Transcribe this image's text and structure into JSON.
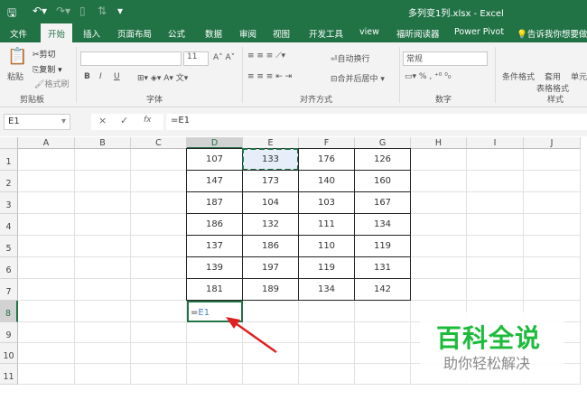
{
  "window": {
    "title": "多列变1列.xlsx  -  Excel",
    "quick_access": [
      "save-icon",
      "undo-icon",
      "redo-icon",
      "print-preview-icon",
      "sort-icon",
      "customize-icon"
    ]
  },
  "tabs": [
    "文件",
    "开始",
    "插入",
    "页面布局",
    "公式",
    "数据",
    "审阅",
    "视图",
    "开发工具",
    "view",
    "福昕阅读器",
    "Power Pivot",
    "告诉我你想要做什么"
  ],
  "ribbon": {
    "clipboard": {
      "paste": "粘贴",
      "cut": "剪切",
      "copy": "复制",
      "format_painter": "格式刷",
      "group": "剪贴板"
    },
    "font": {
      "font_name": "",
      "font_size": "11",
      "bold": "B",
      "italic": "I",
      "underline": "U",
      "group": "字体"
    },
    "alignment": {
      "wrap": "自动换行",
      "merge": "合并后居中",
      "group": "对齐方式"
    },
    "number": {
      "format": "常规",
      "percent": "%",
      "group": "数字"
    },
    "styles": {
      "conditional": "条件格式",
      "table": "套用\n表格格式",
      "cell": "单元",
      "group": "样式"
    }
  },
  "formula_bar": {
    "name_box": "E1",
    "cancel": "×",
    "enter": "✓",
    "fx": "fx",
    "formula": "=E1"
  },
  "columns": [
    "A",
    "B",
    "C",
    "D",
    "E",
    "F",
    "G",
    "H",
    "I",
    "J"
  ],
  "rows": [
    "1",
    "2",
    "3",
    "4",
    "5",
    "6",
    "7",
    "8",
    "9",
    "10",
    "11"
  ],
  "table": [
    [
      "107",
      "133",
      "176",
      "126"
    ],
    [
      "147",
      "173",
      "140",
      "160"
    ],
    [
      "187",
      "104",
      "103",
      "167"
    ],
    [
      "186",
      "132",
      "111",
      "134"
    ],
    [
      "137",
      "186",
      "110",
      "119"
    ],
    [
      "139",
      "197",
      "119",
      "131"
    ],
    [
      "181",
      "189",
      "134",
      "142"
    ]
  ],
  "active_cell": {
    "ref": "D8",
    "eq": "=",
    "ref_text": "E1"
  },
  "watermark": {
    "title": "百科全说",
    "subtitle": "助你轻松解决"
  },
  "colors": {
    "excel_green": "#217346",
    "arrow": "#e02020",
    "watermark_green": "#1dbb3b"
  }
}
